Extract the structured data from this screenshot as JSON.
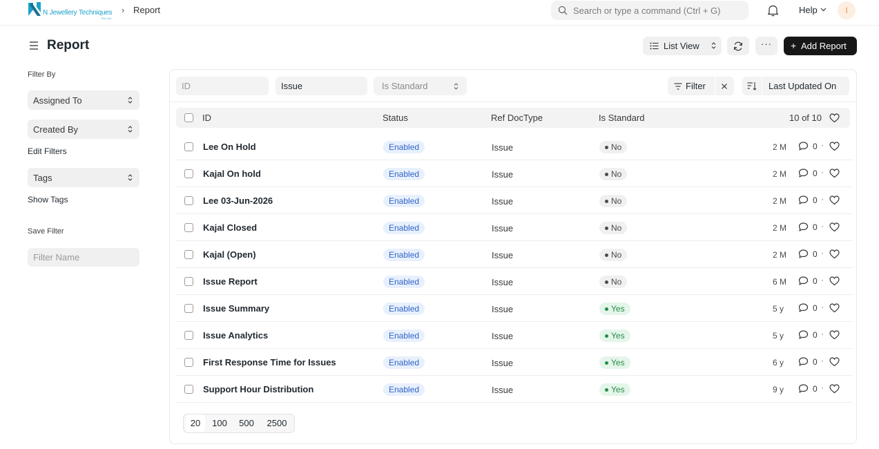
{
  "navbar": {
    "logo_text": "N Jewellery Techniques",
    "logo_sub": "Pvt. Ltd.",
    "breadcrumb_sep": "›",
    "breadcrumb": "Report",
    "search_placeholder": "Search or type a command (Ctrl + G)",
    "help_label": "Help",
    "avatar_letter": "I"
  },
  "page": {
    "title": "Report",
    "list_view_label": "List View",
    "more_label": "···",
    "add_label": "Add Report"
  },
  "sidebar": {
    "filter_by": "Filter By",
    "assigned_to": "Assigned To",
    "created_by": "Created By",
    "edit_filters": "Edit Filters",
    "tags": "Tags",
    "show_tags": "Show Tags",
    "save_filter": "Save Filter",
    "filter_name_placeholder": "Filter Name"
  },
  "filters": {
    "id_placeholder": "ID",
    "issue_value": "Issue",
    "is_standard": "Is Standard",
    "filter_label": "Filter",
    "sort_label": "Last Updated On"
  },
  "table": {
    "columns": {
      "id": "ID",
      "status": "Status",
      "ref_doctype": "Ref DocType",
      "is_standard": "Is Standard"
    },
    "count": "10 of 10",
    "rows": [
      {
        "name": "Lee On Hold",
        "status": "Enabled",
        "ref": "Issue",
        "std": "No",
        "mod": "2 M",
        "comments": "0"
      },
      {
        "name": "Kajal On hold",
        "status": "Enabled",
        "ref": "Issue",
        "std": "No",
        "mod": "2 M",
        "comments": "0"
      },
      {
        "name": "Lee 03-Jun-2026",
        "status": "Enabled",
        "ref": "Issue",
        "std": "No",
        "mod": "2 M",
        "comments": "0"
      },
      {
        "name": "Kajal Closed",
        "status": "Enabled",
        "ref": "Issue",
        "std": "No",
        "mod": "2 M",
        "comments": "0"
      },
      {
        "name": "Kajal (Open)",
        "status": "Enabled",
        "ref": "Issue",
        "std": "No",
        "mod": "2 M",
        "comments": "0"
      },
      {
        "name": "Issue Report",
        "status": "Enabled",
        "ref": "Issue",
        "std": "No",
        "mod": "6 M",
        "comments": "0"
      },
      {
        "name": "Issue Summary",
        "status": "Enabled",
        "ref": "Issue",
        "std": "Yes",
        "mod": "5 y",
        "comments": "0"
      },
      {
        "name": "Issue Analytics",
        "status": "Enabled",
        "ref": "Issue",
        "std": "Yes",
        "mod": "5 y",
        "comments": "0"
      },
      {
        "name": "First Response Time for Issues",
        "status": "Enabled",
        "ref": "Issue",
        "std": "Yes",
        "mod": "6 y",
        "comments": "0"
      },
      {
        "name": "Support Hour Distribution",
        "status": "Enabled",
        "ref": "Issue",
        "std": "Yes",
        "mod": "9 y",
        "comments": "0"
      }
    ],
    "sep": "·"
  },
  "pager": {
    "p20": "20",
    "p100": "100",
    "p500": "500",
    "p2500": "2500"
  },
  "colors": {
    "accent": "#171717",
    "enabled_bg": "#e8f0fd",
    "yes_bg": "#e4f5e9",
    "brand": "#1aa3c8"
  },
  "icons": [
    "search-icon",
    "bell-icon",
    "chevron-down-icon",
    "hamburger-icon",
    "list-icon",
    "refresh-icon",
    "filter-icon",
    "close-icon",
    "sort-icon",
    "heart-icon",
    "comment-icon"
  ]
}
